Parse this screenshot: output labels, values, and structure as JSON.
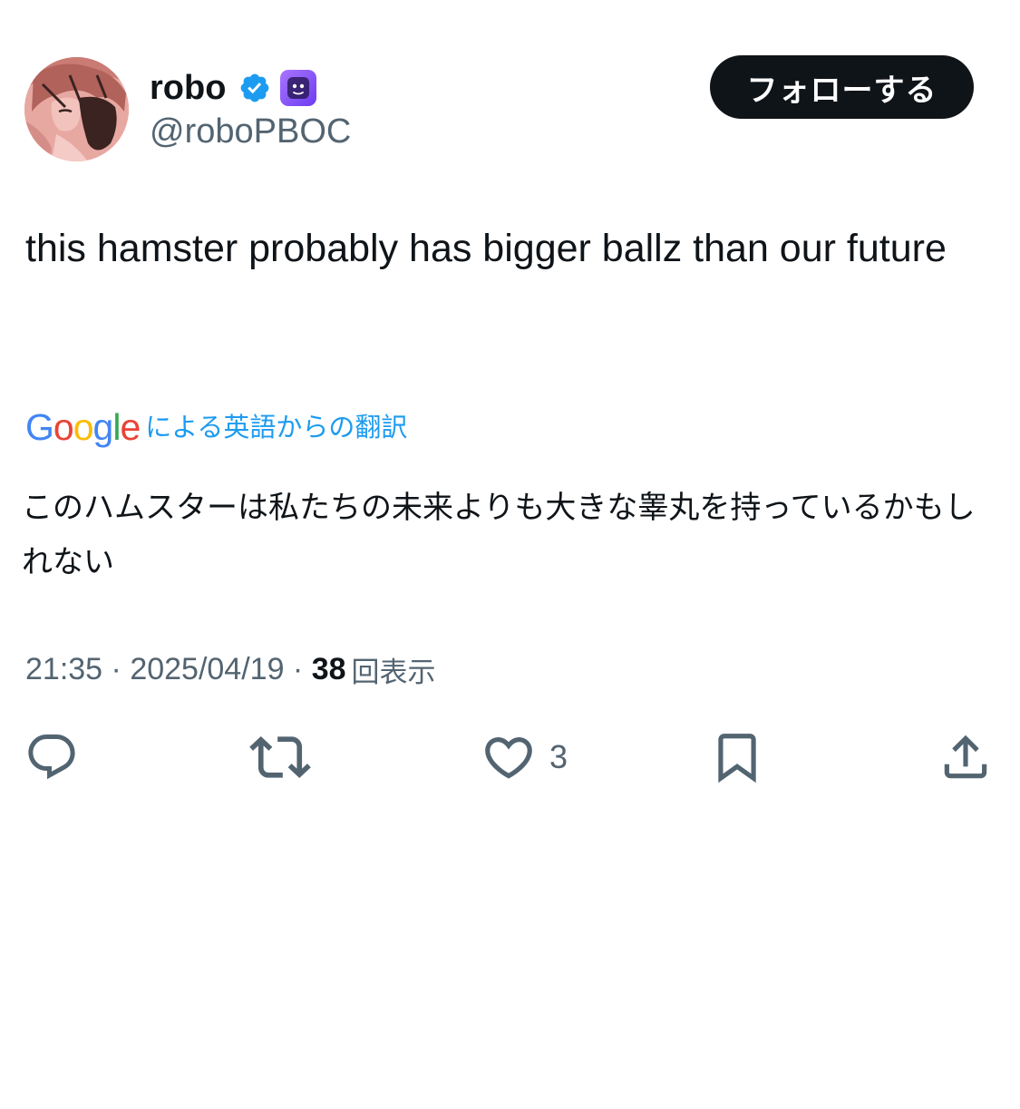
{
  "user": {
    "display_name": "robo",
    "handle": "@roboPBOC"
  },
  "follow_button": {
    "label": "フォローする"
  },
  "tweet": {
    "text": "this hamster probably has bigger ballz than our future"
  },
  "translation": {
    "provider_letters": [
      "G",
      "o",
      "o",
      "g",
      "l",
      "e"
    ],
    "provider_colors": [
      "#4285f4",
      "#ea4335",
      "#fbbc05",
      "#4285f4",
      "#34a853",
      "#ea4335"
    ],
    "label": "による英語からの翻訳",
    "text": "このハムスターは私たちの未来よりも大きな睾丸を持っているかもしれない"
  },
  "meta": {
    "time": "21:35",
    "date": "2025/04/19",
    "separator": " · ",
    "views_count": "38",
    "views_label": "回表示"
  },
  "actions": {
    "reply_icon": "reply-icon",
    "retweet_icon": "retweet-icon",
    "like_icon": "heart-icon",
    "like_count": "3",
    "bookmark_icon": "bookmark-icon",
    "share_icon": "share-icon"
  },
  "colors": {
    "text_primary": "#0f1419",
    "text_secondary": "#536471",
    "link_blue": "#1d9bf0",
    "verified_blue": "#1d9bf0",
    "follow_bg": "#0f1419"
  }
}
